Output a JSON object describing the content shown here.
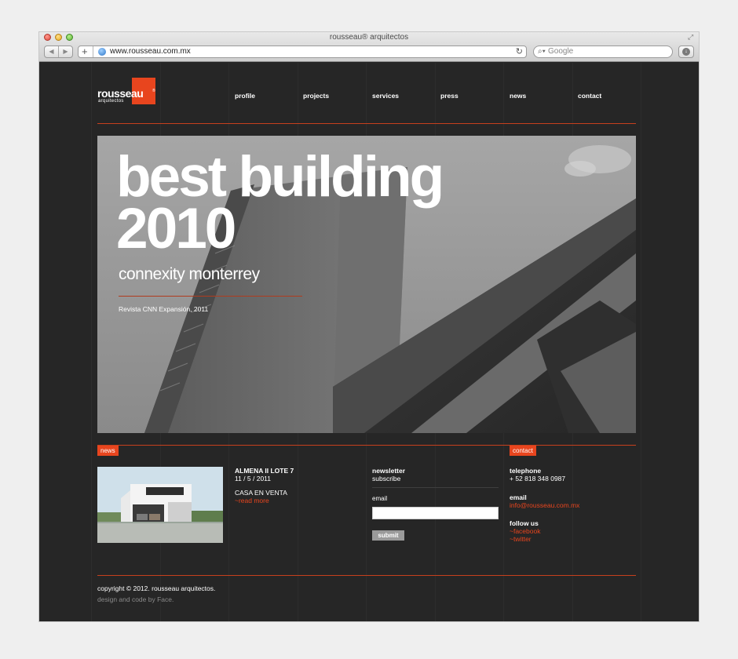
{
  "browser": {
    "title": "rousseau® arquitectos",
    "url": "www.rousseau.com.mx",
    "search_placeholder": "Google",
    "back_icon": "◀",
    "forward_icon": "▶"
  },
  "logo": {
    "word": "rousseau",
    "sub": "arquitectos"
  },
  "nav": {
    "items": [
      {
        "label": "profile"
      },
      {
        "label": "projects"
      },
      {
        "label": "services"
      },
      {
        "label": "press"
      },
      {
        "label": "news"
      },
      {
        "label": "contact"
      }
    ]
  },
  "hero": {
    "title_line1": "best building",
    "title_line2": "2010",
    "subtitle": "connexity monterrey",
    "source": "Revista CNN Expansión, 2011"
  },
  "news": {
    "tag": "news",
    "title": "ALMENA II LOTE 7",
    "date": "11 / 5 / 2011",
    "headline": "CASA EN VENTA",
    "more": "~read more"
  },
  "newsletter": {
    "title": "newsletter",
    "sub": "subscribe",
    "email_label": "email",
    "email_value": "",
    "submit": "submit"
  },
  "contact": {
    "tag": "contact",
    "telephone_label": "telephone",
    "telephone": "+ 52 818 348 0987",
    "email_label": "email",
    "email": "info@rousseau.com.mx",
    "follow_label": "follow us",
    "facebook": "~facebook",
    "twitter": "~twitter"
  },
  "footer": {
    "copyright": "copyright © 2012. rousseau arquitectos.",
    "credit": "design and code by Face."
  },
  "colors": {
    "accent": "#e8451e",
    "background": "#262626"
  }
}
